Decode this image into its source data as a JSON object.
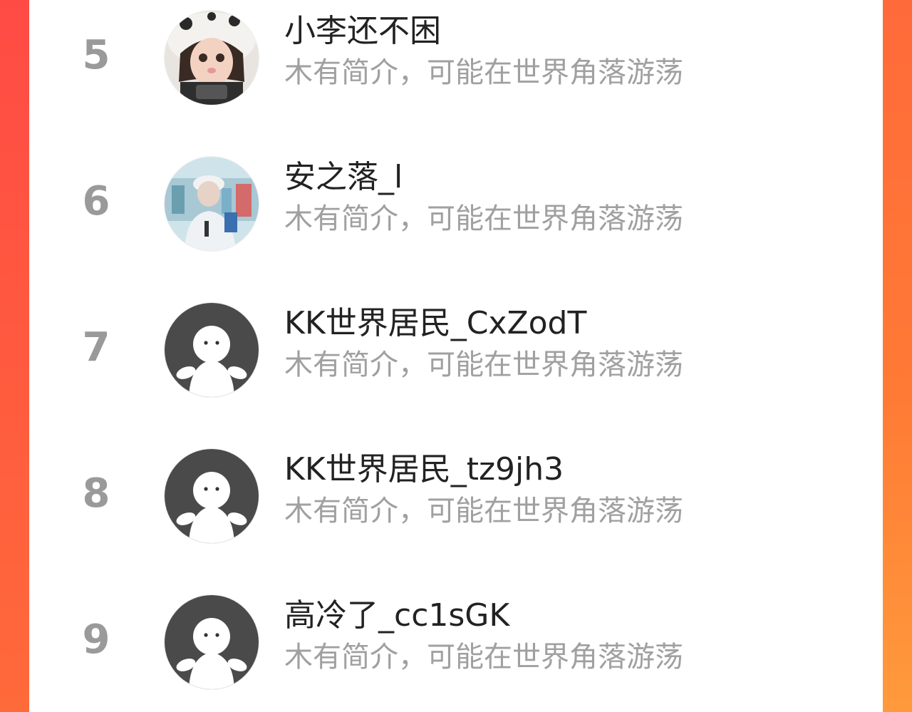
{
  "ranking": {
    "rows": [
      {
        "rank": "5",
        "name": "小李还不困",
        "bio": "木有简介，可能在世界角落游荡",
        "avatar": "photo-girl-avatar"
      },
      {
        "rank": "6",
        "name": "安之落_l",
        "bio": "木有简介，可能在世界角落游荡",
        "avatar": "photo-person-cap-avatar"
      },
      {
        "rank": "7",
        "name": "KK世界居民_CxZodT",
        "bio": "木有简介，可能在世界角落游荡",
        "avatar": "default-ghost-avatar"
      },
      {
        "rank": "8",
        "name": "KK世界居民_tz9jh3",
        "bio": "木有简介，可能在世界角落游荡",
        "avatar": "default-ghost-avatar"
      },
      {
        "rank": "9",
        "name": "高冷了_cc1sGK",
        "bio": "木有简介，可能在世界角落游荡",
        "avatar": "default-ghost-avatar"
      }
    ]
  },
  "colors": {
    "frame_left": "#ff4b45",
    "frame_right": "#ff7a35",
    "rank_text": "#9a9a9a",
    "name_text": "#222222",
    "bio_text": "#a0a0a0",
    "default_avatar_bg": "#4a4a4a"
  }
}
